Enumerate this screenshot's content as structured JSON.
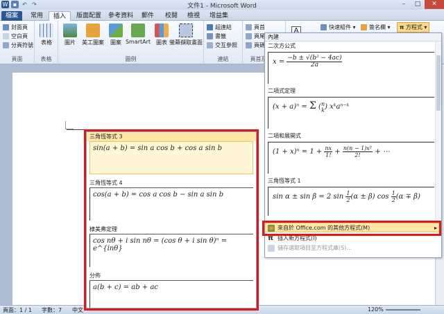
{
  "window": {
    "title": "文件1 - Microsoft Word"
  },
  "tabs": [
    {
      "label": "檔案"
    },
    {
      "label": "常用"
    },
    {
      "label": "插入"
    },
    {
      "label": "版面配置"
    },
    {
      "label": "參考資料"
    },
    {
      "label": "郵件"
    },
    {
      "label": "校閱"
    },
    {
      "label": "檢視"
    },
    {
      "label": "增益集"
    }
  ],
  "ribbon": {
    "pages": {
      "cover": "封面頁",
      "blank": "空白頁",
      "break": "分頁符號",
      "label": "頁面"
    },
    "tables": {
      "table": "表格",
      "label": "表格"
    },
    "illustrations": {
      "picture": "圖片",
      "clipart": "美工圖案",
      "shapes": "圖案",
      "smartart": "SmartArt",
      "chart": "圖表",
      "screenshot": "螢幕擷取畫面",
      "label": "圖例"
    },
    "links": {
      "hyperlink": "超連結",
      "bookmark": "書籤",
      "crossref": "交互參照",
      "label": "連結"
    },
    "header": {
      "header": "頁首",
      "footer": "頁尾",
      "pagenum": "頁碼",
      "label": "頁首及頁尾"
    },
    "text": {
      "quickparts": "快速組件",
      "signature": "簽名欄",
      "equation": "方程式"
    }
  },
  "dropdown_left": {
    "sections": [
      {
        "title": "三角恆等式 3",
        "equation": "sin(a + b) = sin a cos b + cos a sin b"
      },
      {
        "title": "三角恆等式 4",
        "equation": "cos(a + b) = cos a cos b − sin a sin b"
      },
      {
        "title": "棣美弗定理",
        "equation": "cos nθ + i sin nθ = (cos θ + i sin θ)ⁿ = e^{inθ}"
      },
      {
        "title": "分佈",
        "equation": "a(b + c) = ab + ac"
      }
    ]
  },
  "dropdown_right": {
    "header": "內建",
    "sections": [
      {
        "title": "二次方公式"
      },
      {
        "title": "二項式定理"
      },
      {
        "title": "二項和展開式"
      },
      {
        "title": "三角恆等式 1"
      }
    ],
    "menu": [
      {
        "label": "來自於 Office.com 的其他方程式(M)"
      },
      {
        "label": "插入新方程式(I)"
      },
      {
        "label": "儲存選取項目至方程式庫(S)..."
      }
    ]
  },
  "status": {
    "page": "頁面：1 / 1",
    "words": "字數：7",
    "lang": "中文",
    "zoom": "120%"
  }
}
